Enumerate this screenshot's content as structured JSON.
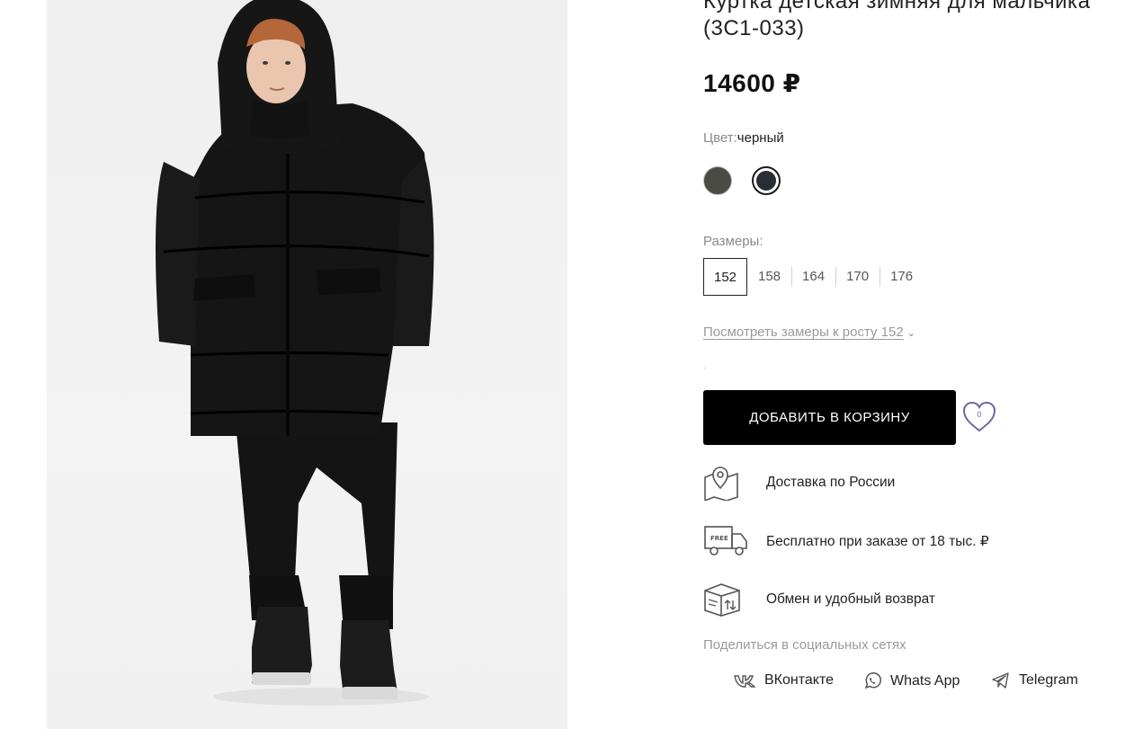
{
  "product": {
    "title_line1": "Куртка детская зимняя для мальчика",
    "title_line2": "(3С1-033)",
    "price": "14600 ₽"
  },
  "color": {
    "label": "Цвет:",
    "value": "черный",
    "swatches": [
      {
        "name": "olive",
        "hex": "#4b4b46"
      },
      {
        "name": "black",
        "hex": "#2a2d35",
        "selected": true
      }
    ]
  },
  "sizes": {
    "label": "Размеры:",
    "items": [
      "152",
      "158",
      "164",
      "170",
      "176"
    ],
    "selected": "152"
  },
  "measure_link": "Посмотреть замеры к росту 152",
  "cart": {
    "button_label": "ДОБАВИТЬ В КОРЗИНУ",
    "favorites_count": "0"
  },
  "features": [
    {
      "icon": "map-pin-icon",
      "text": "Доставка по России"
    },
    {
      "icon": "free-truck-icon",
      "text": "Бесплатно при заказе от 18 тыс. ₽"
    },
    {
      "icon": "box-return-icon",
      "text": "Обмен и удобный возврат"
    }
  ],
  "share": {
    "label": "Поделиться в социальных сетях",
    "networks": [
      "ВКонтакте",
      "Whats App",
      "Telegram"
    ]
  },
  "colors": {
    "accent": "#6a6aa0",
    "button_bg": "#000000"
  }
}
